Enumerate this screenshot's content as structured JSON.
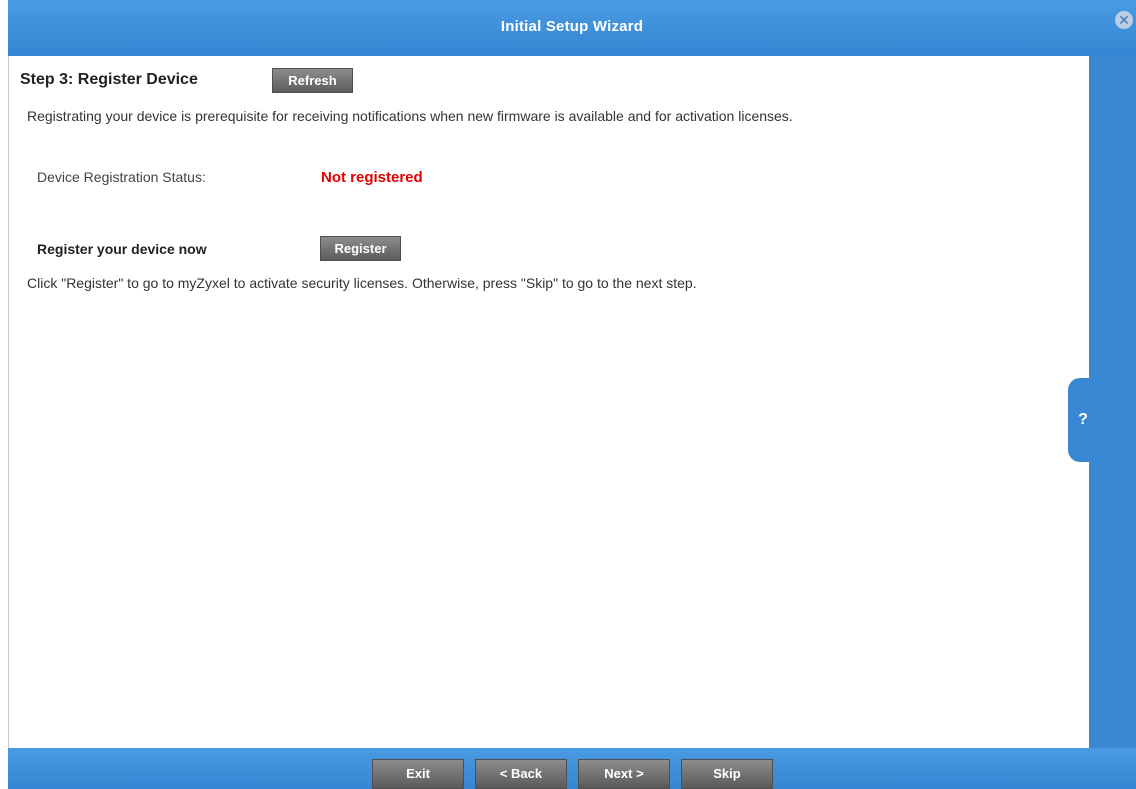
{
  "window": {
    "title": "Initial Setup Wizard",
    "close_icon": "close-icon",
    "close_glyph": "✕"
  },
  "step": {
    "title": "Step 3: Register Device",
    "refresh_label": "Refresh",
    "description": "Registrating your device is prerequisite for receiving notifications when new firmware is available and for activation licenses.",
    "status_label": "Device Registration Status:",
    "status_value": "Not registered",
    "status_color": "#e00000",
    "register_label": "Register your device now",
    "register_button": "Register",
    "instructions": "Click \"Register\" to go to myZyxel to activate security licenses. Otherwise, press \"Skip\" to go to the next step."
  },
  "help": {
    "label": "?"
  },
  "footer": {
    "exit": "Exit",
    "back": "< Back",
    "next": "Next >",
    "skip": "Skip"
  },
  "colors": {
    "accent": "#3a88d4",
    "button": "#6e6e6e"
  }
}
